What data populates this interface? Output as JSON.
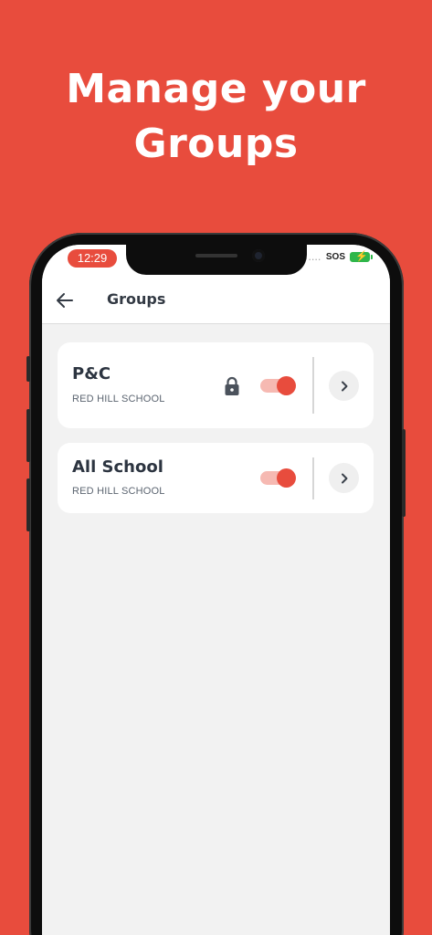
{
  "headline": {
    "line1": "Manage your",
    "line2": "Groups"
  },
  "status_bar": {
    "time": "12:29",
    "signal": "....",
    "carrier": "SOS",
    "battery_icon": "battery-charging-icon"
  },
  "app_bar": {
    "back_icon": "arrow-left-icon",
    "title": "Groups"
  },
  "groups": [
    {
      "name": "P&C",
      "school": "RED HILL SCHOOL",
      "locked": true,
      "enabled": true,
      "open_icon": "chevron-right-icon"
    },
    {
      "name": "All School",
      "school": "RED HILL SCHOOL",
      "locked": false,
      "enabled": true,
      "open_icon": "chevron-right-icon"
    }
  ],
  "colors": {
    "brand": "#E84C3D",
    "toggle_track": "#f6b9b2",
    "screen_bg": "#f2f2f2"
  }
}
